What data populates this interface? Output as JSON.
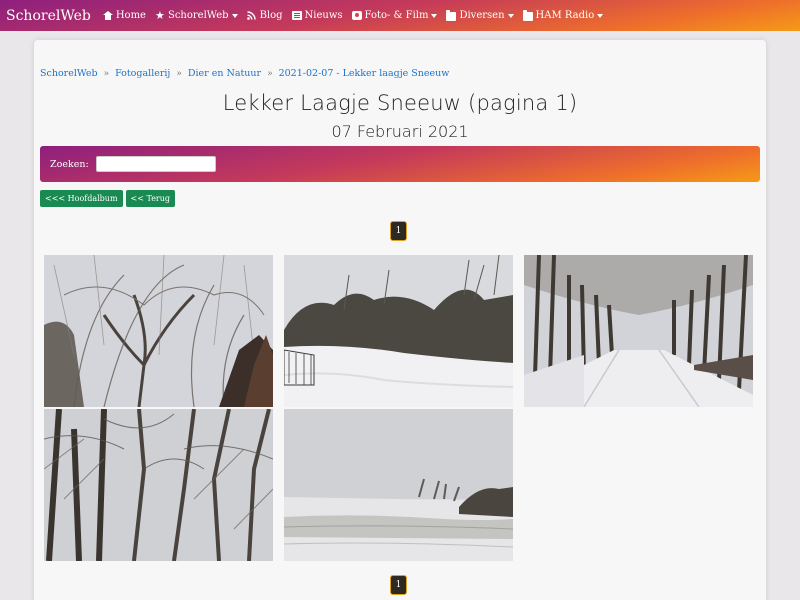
{
  "navbar": {
    "brand": "SchorelWeb",
    "items": [
      {
        "label": "Home",
        "icon": "home-icon",
        "dropdown": false
      },
      {
        "label": "SchorelWeb",
        "icon": "star-icon",
        "dropdown": true
      },
      {
        "label": "Blog",
        "icon": "rss-icon",
        "dropdown": false
      },
      {
        "label": "Nieuws",
        "icon": "news-icon",
        "dropdown": false
      },
      {
        "label": "Foto- & Film",
        "icon": "camera-icon",
        "dropdown": true
      },
      {
        "label": "Diversen",
        "icon": "folder-icon",
        "dropdown": true
      },
      {
        "label": "HAM Radio",
        "icon": "folder-icon",
        "dropdown": true
      }
    ]
  },
  "breadcrumb": {
    "items": [
      "SchorelWeb",
      "Fotogallerij",
      "Dier en Natuur",
      "2021-02-07 - Lekker laagje Sneeuw"
    ],
    "separator": "»"
  },
  "page": {
    "title": "Lekker Laagje Sneeuw (pagina 1)",
    "date": "07 Februari 2021"
  },
  "search": {
    "label": "Zoeken:",
    "value": ""
  },
  "buttons": {
    "main_album": "<<< Hoofdalbum",
    "back": "<< Terug"
  },
  "pagination": {
    "top_page": "1",
    "bottom_page": "1"
  },
  "gallery": {
    "photos": [
      "snowy-willow-trees",
      "snow-field-with-bushes",
      "snowy-tree-lane",
      "bare-tree-trunks",
      "snow-covered-field"
    ]
  },
  "colors": {
    "gradient_start": "#8d1f7e",
    "gradient_mid": "#c53a5a",
    "gradient_end": "#f59a17",
    "button_green": "#1a8a53",
    "link_blue": "#1a73c9",
    "pagination_bg": "#2e2a22",
    "pagination_border": "#e0a020"
  }
}
